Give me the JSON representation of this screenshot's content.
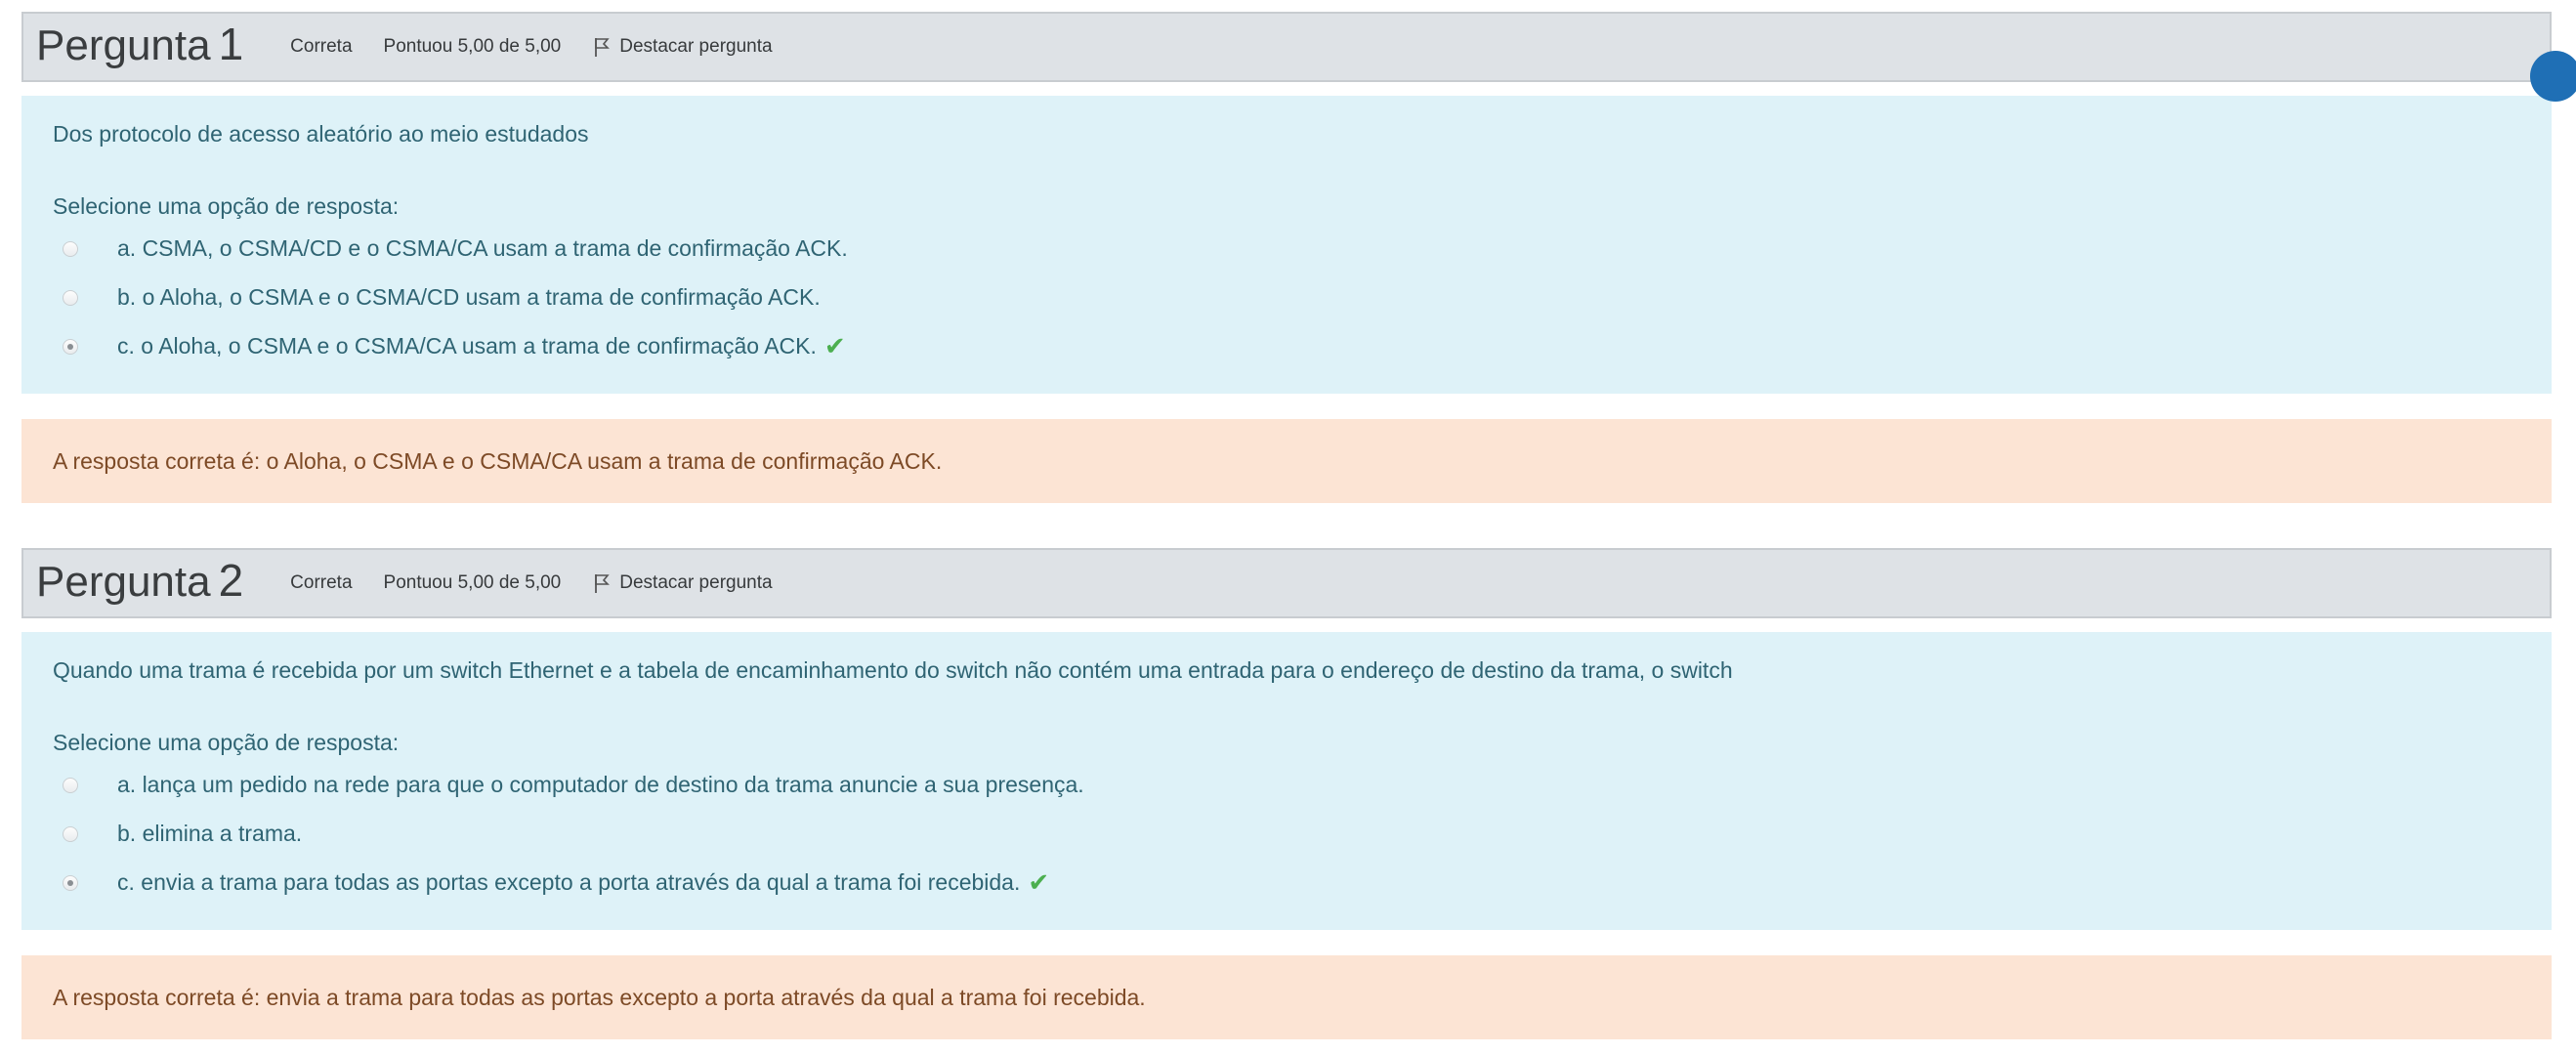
{
  "questions": [
    {
      "title": "Pergunta",
      "number": "1",
      "state": "Correta",
      "grade": "Pontuou 5,00 de 5,00",
      "flag_label": "Destacar pergunta",
      "text": "Dos protocolo de acesso aleatório ao meio estudados",
      "prompt": "Selecione uma opção de resposta:",
      "answers": [
        {
          "label": "a. CSMA, o CSMA/CD e o CSMA/CA usam a trama de confirmação ACK.",
          "selected": false
        },
        {
          "label": "b. o Aloha, o CSMA e o CSMA/CD usam a trama de confirmação ACK.",
          "selected": false
        },
        {
          "label": "c. o Aloha, o CSMA e o CSMA/CA usam a trama de confirmação ACK.",
          "selected": true
        }
      ],
      "feedback": "A resposta correta é: o Aloha, o CSMA e o CSMA/CA usam a trama de confirmação ACK."
    },
    {
      "title": "Pergunta",
      "number": "2",
      "state": "Correta",
      "grade": "Pontuou 5,00 de 5,00",
      "flag_label": "Destacar pergunta",
      "text": "Quando uma trama é recebida por um switch Ethernet e a tabela de encaminhamento do switch não contém uma entrada para o endereço de destino da trama, o switch",
      "prompt": "Selecione uma opção de resposta:",
      "answers": [
        {
          "label": "a. lança um pedido na rede para que o computador de destino da trama anuncie a sua presença.",
          "selected": false
        },
        {
          "label": "b. elimina a trama.",
          "selected": false
        },
        {
          "label": "c. envia a trama para todas as portas excepto a porta através da qual a trama foi recebida.",
          "selected": true
        }
      ],
      "feedback": "A resposta correta é: envia a trama para todas as portas excepto a porta através da qual a trama foi recebida."
    }
  ],
  "colors": {
    "info_bg": "#dee2e6",
    "formulation_bg": "#def2f8",
    "feedback_bg": "#fce4d4",
    "correct_tick": "#4caf50"
  },
  "icons": {
    "flag": "flag-icon",
    "correct": "check-icon"
  }
}
